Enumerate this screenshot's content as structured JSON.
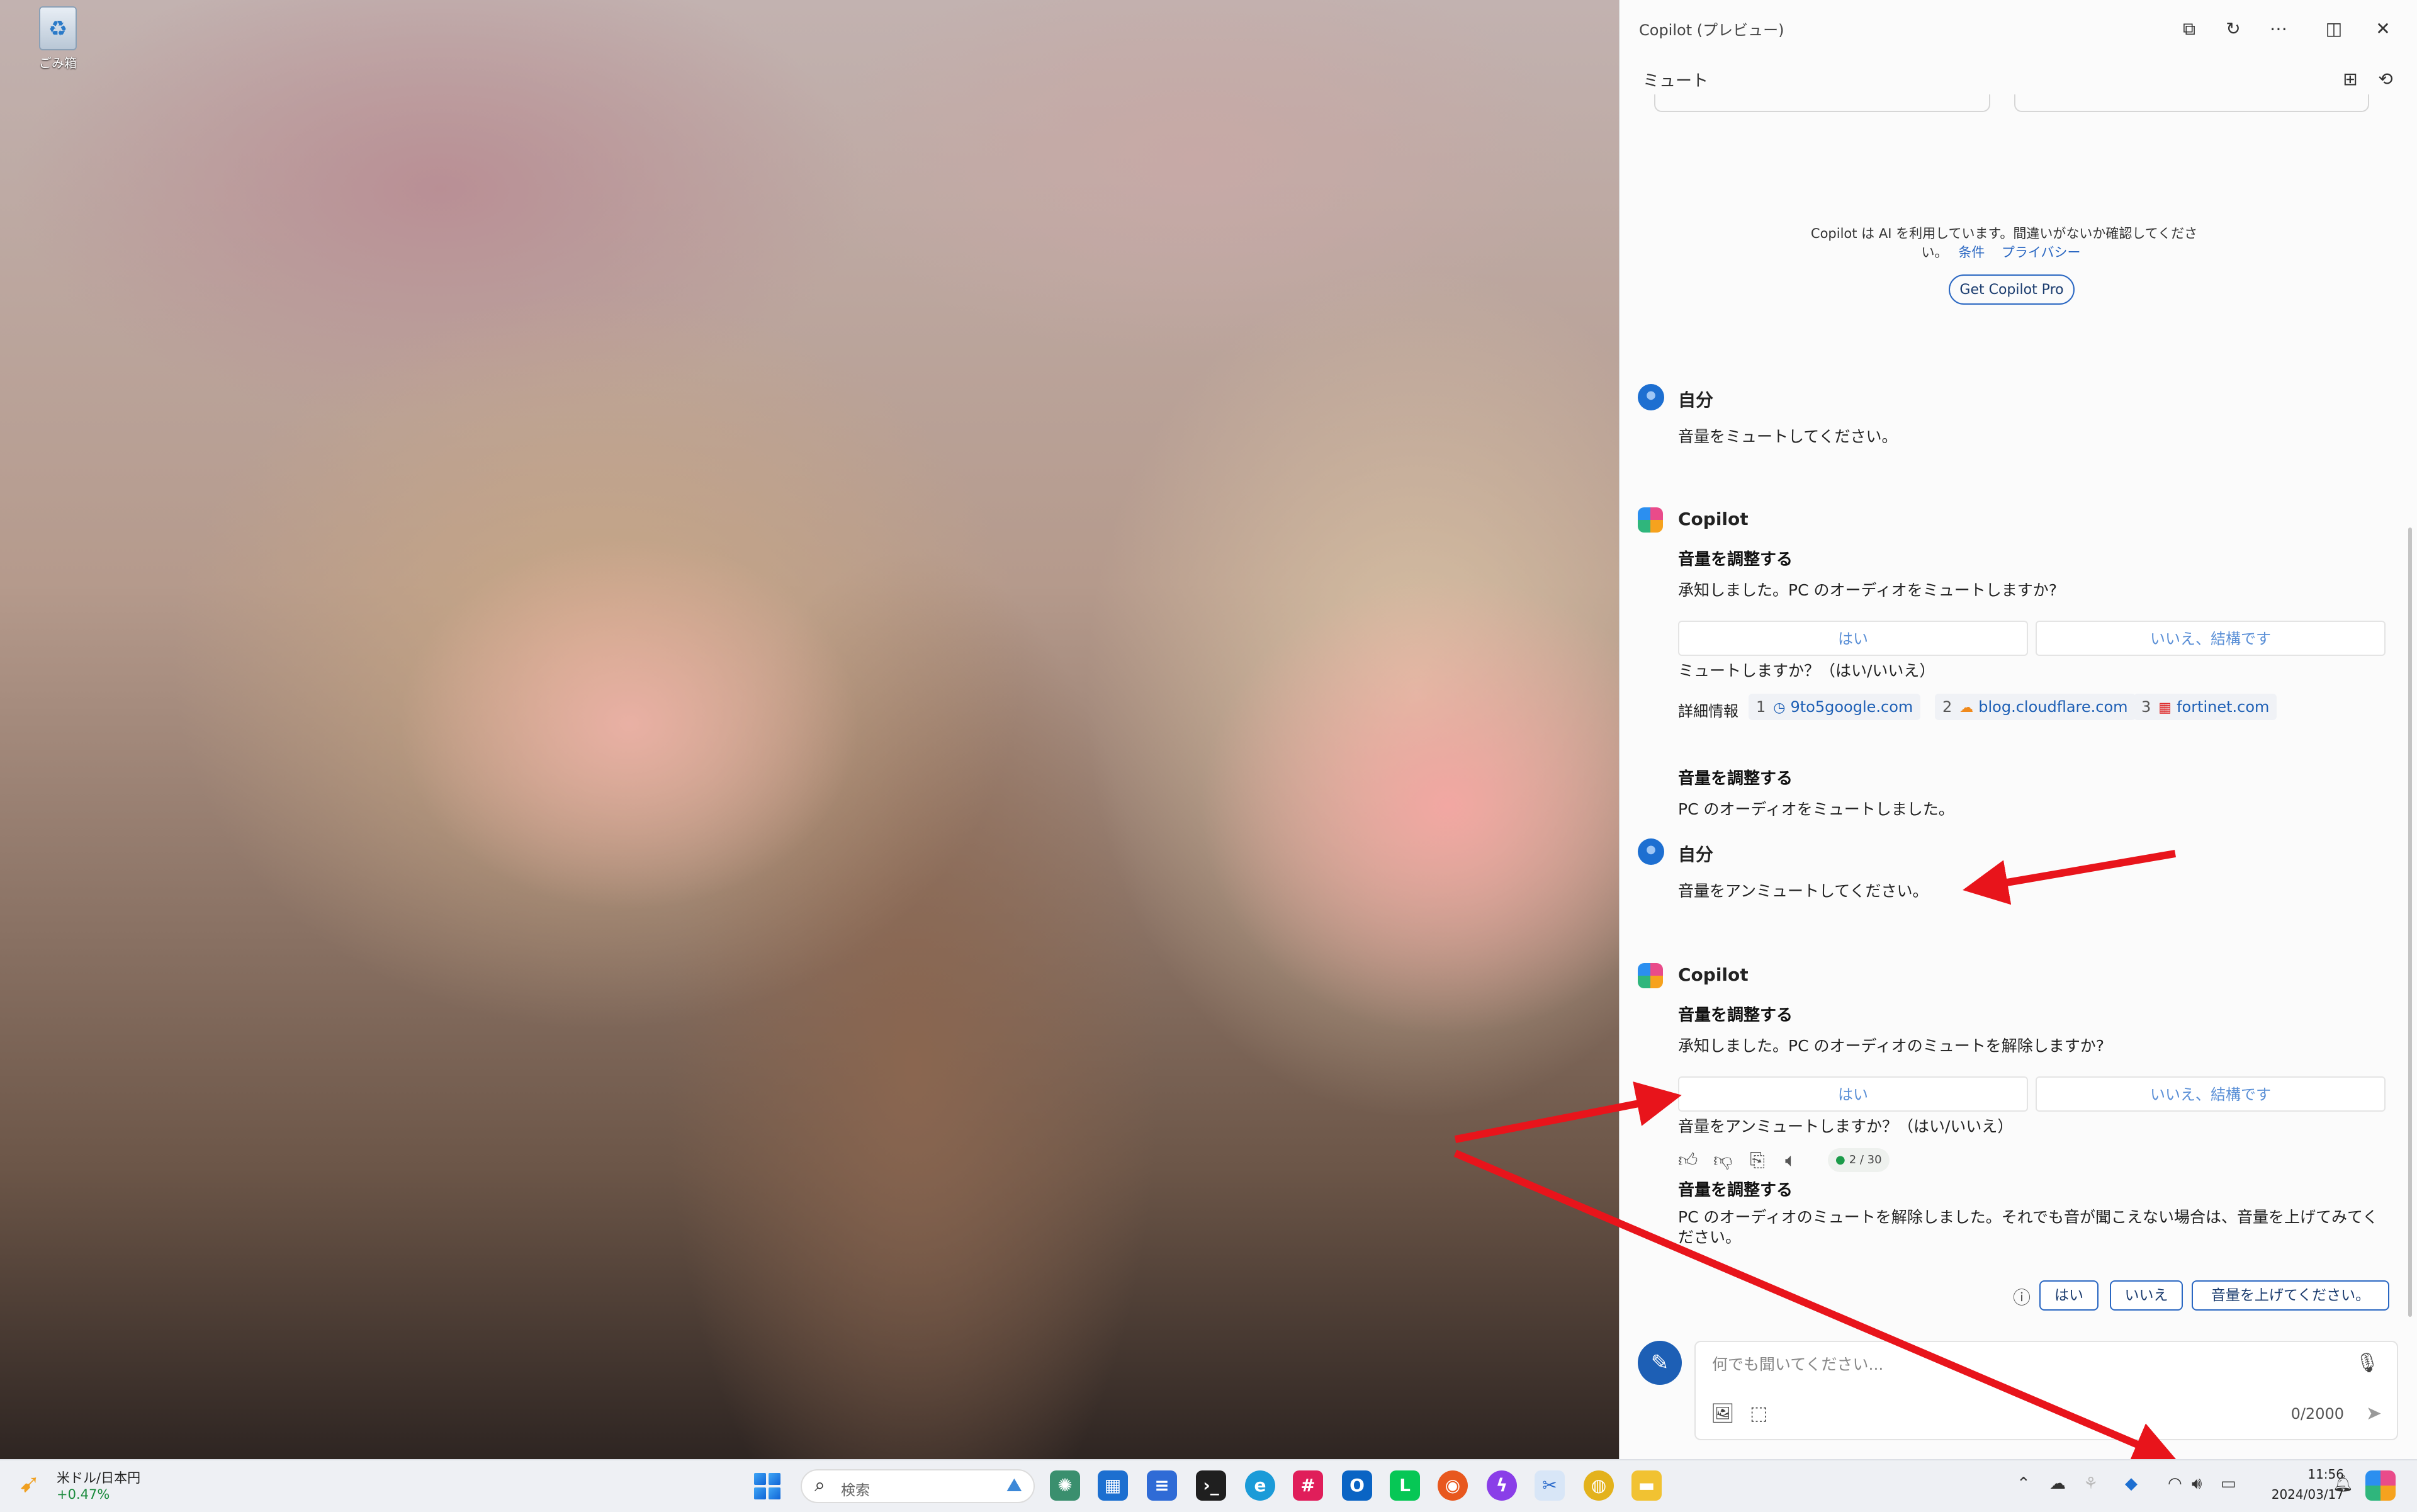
{
  "desktop": {
    "recycle_bin_label": "ごみ箱"
  },
  "copilot": {
    "title": "Copilot (プレビュー)",
    "subheader": "ミュート",
    "disclaimer": "Copilot は AI を利用しています。間違いがないか確認してください。",
    "link_terms": "条件",
    "link_privacy": "プライバシー",
    "pro_button": "Get Copilot Pro",
    "messages": [
      {
        "speaker": "自分",
        "text": "音量をミュートしてください。"
      },
      {
        "speaker": "Copilot",
        "heading": "音量を調整する",
        "text": "承知しました。PC のオーディオをミュートしますか?",
        "yes": "はい",
        "no": "いいえ、結構です",
        "prompt": "ミュートしますか？（はい/いいえ）"
      },
      {
        "heading": "音量を調整する",
        "text": "PC のオーディオをミュートしました。"
      },
      {
        "speaker": "自分",
        "text": "音量をアンミュートしてください。"
      },
      {
        "speaker": "Copilot",
        "heading": "音量を調整する",
        "text": "承知しました。PC のオーディオのミュートを解除しますか?",
        "yes": "はい",
        "no": "いいえ、結構です",
        "prompt": "音量をアンミュートしますか？（はい/いいえ）"
      },
      {
        "heading": "音量を調整する",
        "text": "PC のオーディオのミュートを解除しました。それでも音が聞こえない場合は、音量を上げてみてください。"
      }
    ],
    "sources_label": "詳細情報",
    "sources": [
      {
        "n": "1",
        "site": "9to5google.com"
      },
      {
        "n": "2",
        "site": "blog.cloudflare.com"
      },
      {
        "n": "3",
        "site": "fortinet.com"
      }
    ],
    "turn_counter": "2 / 30",
    "suggestions": [
      "はい",
      "いいえ",
      "音量を上げてください。"
    ],
    "input_placeholder": "何でも聞いてください...",
    "char_count": "0/2000"
  },
  "taskbar": {
    "weather_label": "米ドル/日本円",
    "weather_value": "+0.47%",
    "search_placeholder": "検索",
    "time": "11:56",
    "date": "2024/03/17"
  },
  "colors": {
    "accent": "#2a67c2",
    "annotation_arrow": "#e8141b"
  }
}
